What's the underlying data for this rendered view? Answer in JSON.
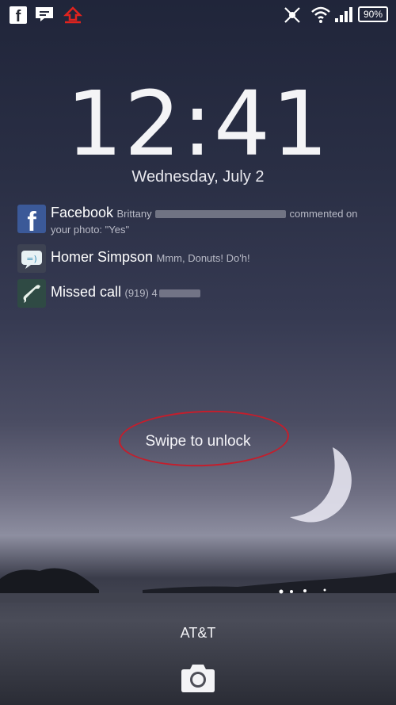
{
  "status_bar": {
    "icons": [
      "facebook-icon",
      "message-icon",
      "upload-icon",
      "mute-icon",
      "wifi-icon",
      "signal-icon"
    ],
    "battery": "90%"
  },
  "clock": {
    "time": "12:41",
    "date": "Wednesday, July 2"
  },
  "notifications": [
    {
      "icon": "facebook-icon",
      "title": "Facebook",
      "body_start": "Brittany",
      "body_end": "commented on",
      "body_line2": "your photo: \"Yes\""
    },
    {
      "icon": "message-icon",
      "title": "Homer Simpson",
      "body": "Mmm, Donuts! Do'h!"
    },
    {
      "icon": "missed-call-icon",
      "title": "Missed call",
      "body": "(919) 4"
    }
  ],
  "lock": {
    "swipe_label": "Swipe to unlock"
  },
  "carrier": "AT&T",
  "camera_icon": "camera-icon",
  "colors": {
    "annotation_circle": "#c41e2c",
    "facebook": "#3b5998"
  }
}
